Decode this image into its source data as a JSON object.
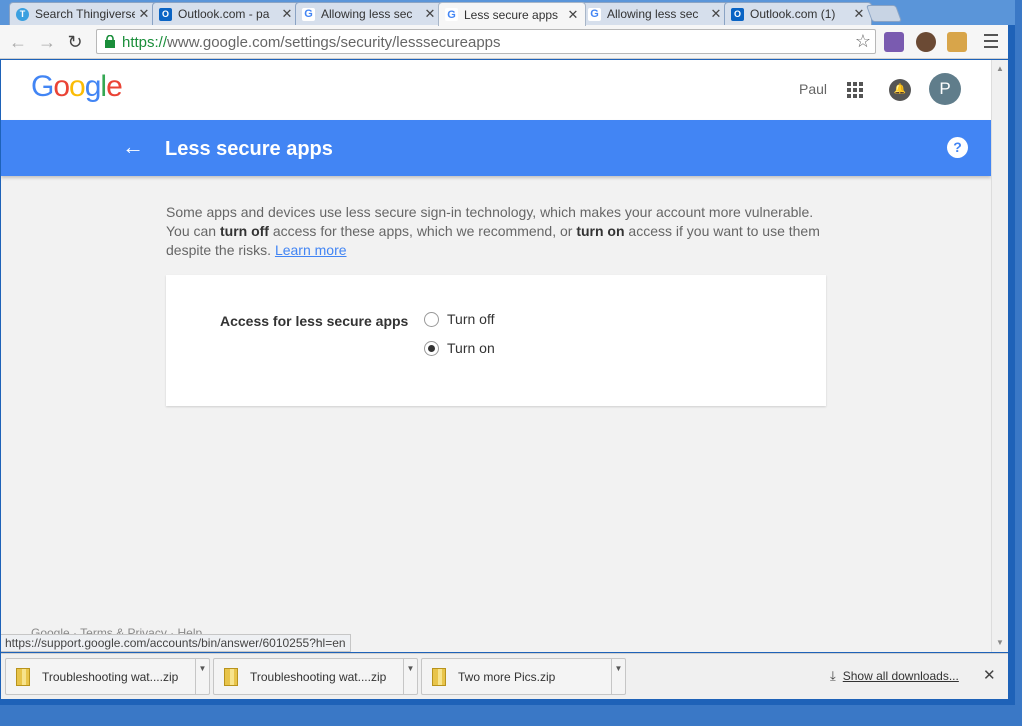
{
  "tabs": [
    {
      "title": "Search Thingiverse",
      "favicon": "thingiverse-icon",
      "active": false
    },
    {
      "title": "Outlook.com - pa",
      "favicon": "outlook-icon",
      "active": false
    },
    {
      "title": "Allowing less sec",
      "favicon": "google-icon",
      "active": false
    },
    {
      "title": "Less secure apps",
      "favicon": "google-icon",
      "active": true
    },
    {
      "title": "Allowing less sec",
      "favicon": "google-icon",
      "active": false
    },
    {
      "title": "Outlook.com (1)",
      "favicon": "outlook-icon",
      "active": false
    }
  ],
  "omnibox": {
    "scheme": "https://",
    "url_rest": "www.google.com/settings/security/lesssecureapps"
  },
  "header": {
    "logo": "Google",
    "user_name": "Paul",
    "avatar_letter": "P"
  },
  "bluebar": {
    "title": "Less secure apps",
    "help": "?"
  },
  "description": {
    "line1": "Some apps and devices use less secure sign-in technology, which makes your account more vulnerable.",
    "line2a": "You can ",
    "turn_off": "turn off",
    "line2b": " access for these apps, which we recommend, or ",
    "turn_on": "turn on",
    "line2c": " access if you want to use them",
    "line3": "despite the risks. ",
    "learn_more": "Learn more"
  },
  "setting": {
    "label": "Access for less secure apps",
    "options": [
      {
        "label": "Turn off",
        "checked": false
      },
      {
        "label": "Turn on",
        "checked": true
      }
    ]
  },
  "footer": {
    "links": "Google · Terms & Privacy · Help"
  },
  "status_url": "https://support.google.com/accounts/bin/answer/6010255?hl=en",
  "downloads": [
    {
      "name": "Troubleshooting wat....zip"
    },
    {
      "name": "Troubleshooting wat....zip"
    },
    {
      "name": "Two more Pics.zip"
    }
  ],
  "show_all": "Show all downloads...",
  "colors": {
    "brand_blue": "#4285f4",
    "omnibox_https": "#1a8e3a"
  }
}
